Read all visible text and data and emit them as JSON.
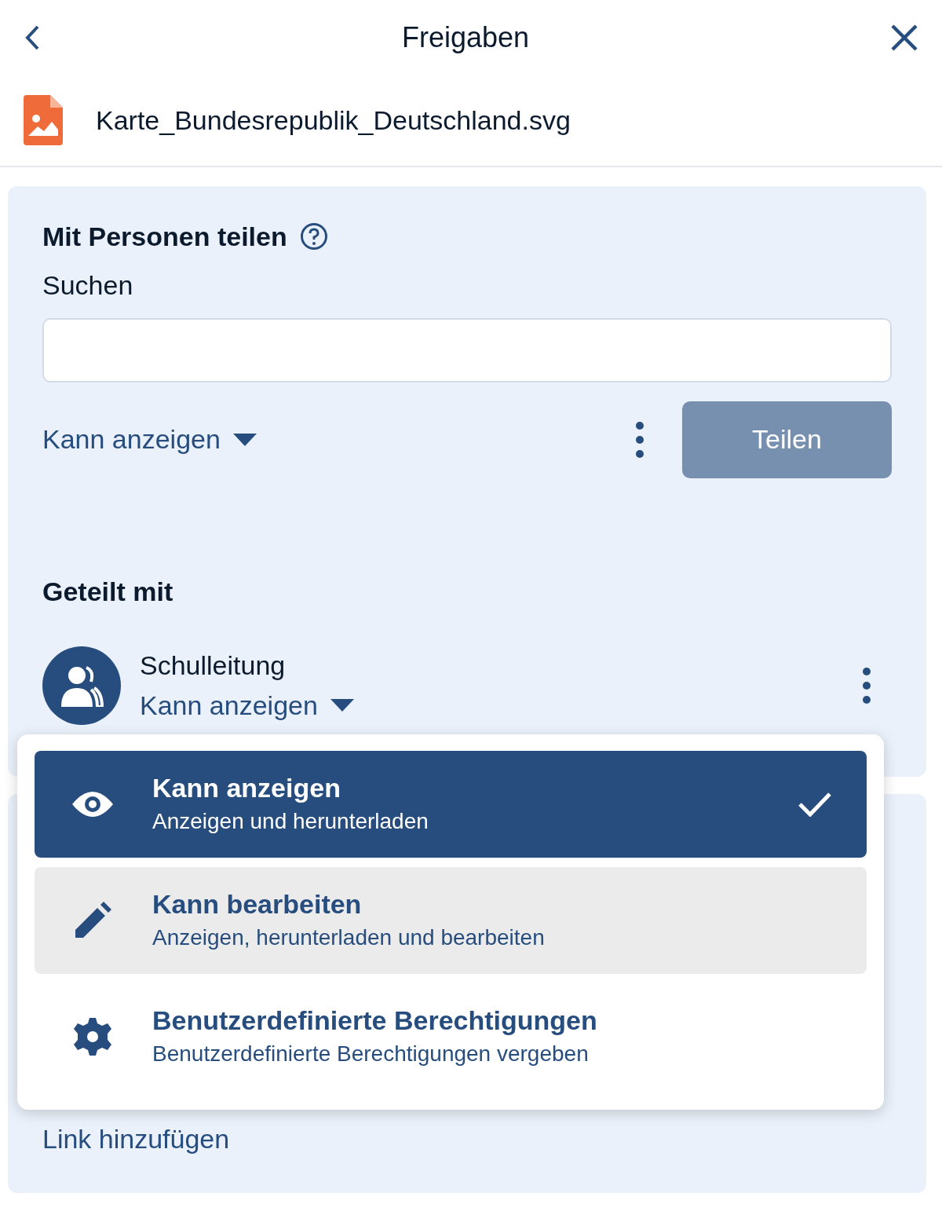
{
  "header": {
    "title": "Freigaben"
  },
  "file": {
    "name": "Karte_Bundesrepublik_Deutschland.svg"
  },
  "share_with_people": {
    "title": "Mit Personen teilen",
    "search_label": "Suchen",
    "permission": "Kann anzeigen",
    "share_button": "Teilen",
    "share_button_disabled": true
  },
  "shared_with": {
    "title": "Geteilt mit",
    "entries": [
      {
        "name": "Schulleitung",
        "permission": "Kann anzeigen"
      }
    ]
  },
  "permission_menu": {
    "items": [
      {
        "kind": "view",
        "title": "Kann anzeigen",
        "description": "Anzeigen und herunterladen",
        "selected": true,
        "hovered": false
      },
      {
        "kind": "edit",
        "title": "Kann bearbeiten",
        "description": "Anzeigen, herunterladen und bearbeiten",
        "selected": false,
        "hovered": true
      },
      {
        "kind": "custom",
        "title": "Benutzerdefinierte Berechtigungen",
        "description": "Benutzerdefinierte Berechtigungen vergeben",
        "selected": false,
        "hovered": false
      }
    ]
  },
  "link_section": {
    "label": "Link hinzufügen"
  }
}
